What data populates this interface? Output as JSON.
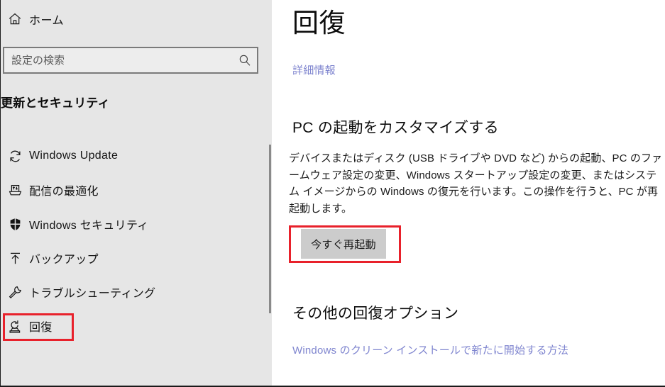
{
  "sidebar": {
    "home": {
      "label": "ホーム",
      "icon": "home-icon"
    },
    "search": {
      "value": "",
      "placeholder": "設定の検索",
      "icon": "search-icon"
    },
    "category_heading": "更新とセキュリティ",
    "items": [
      {
        "label": "Windows Update",
        "icon": "sync-icon",
        "selected": false
      },
      {
        "label": "配信の最適化",
        "icon": "delivery-icon",
        "selected": false
      },
      {
        "label": "Windows セキュリティ",
        "icon": "shield-icon",
        "selected": false
      },
      {
        "label": "バックアップ",
        "icon": "upload-arrow-icon",
        "selected": false
      },
      {
        "label": "トラブルシューティング",
        "icon": "wrench-icon",
        "selected": false
      },
      {
        "label": "回復",
        "icon": "recovery-icon",
        "selected": true
      }
    ]
  },
  "content": {
    "title": "回復",
    "more_info_link": "詳細情報",
    "custom_startup": {
      "heading": "PC の起動をカスタマイズする",
      "description": "デバイスまたはディスク (USB ドライブや DVD など) からの起動、PC のファームウェア設定の変更、Windows スタートアップ設定の変更、またはシステム イメージからの Windows の復元を行います。この操作を行うと、PC が再起動します。",
      "restart_button": "今すぐ再起動"
    },
    "other_options": {
      "heading": "その他の回復オプション",
      "clean_install_link": "Windows のクリーン インストールで新たに開始する方法"
    }
  },
  "colors": {
    "sidebar_bg": "#E6E6E6",
    "content_bg": "#FFFFFF",
    "link": "#7F85CF",
    "highlight_red": "#E8212B",
    "button_bg": "#CCCCCC"
  }
}
